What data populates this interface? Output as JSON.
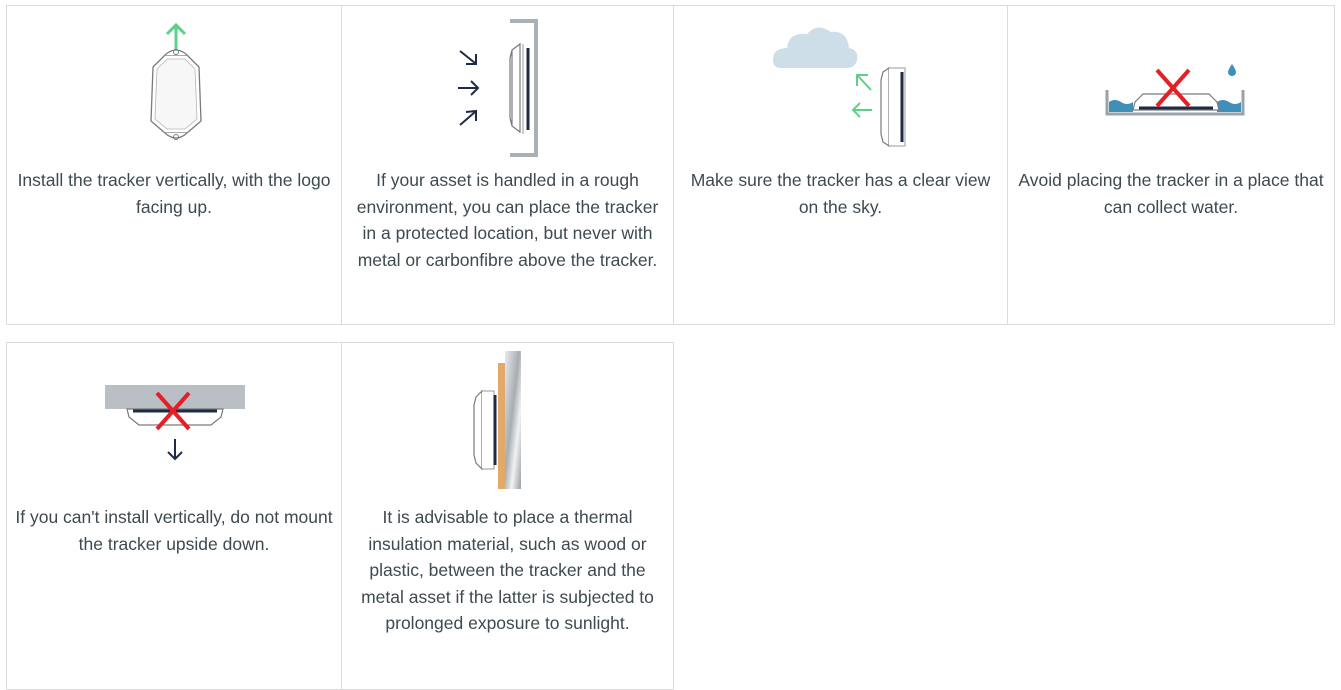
{
  "colors": {
    "arrow_green": "#5fd08a",
    "arrow_navy": "#1f2a44",
    "cross_red": "#e51f26",
    "water_blue": "#3f8fb8",
    "cloud": "#cddee9",
    "wood": "#e2a96b",
    "card_border": "#dcdcdc"
  },
  "tips": [
    {
      "caption": "Install the tracker vertically, with the logo facing up.",
      "illustration": "tracker-vertical-arrow-up"
    },
    {
      "caption": "If your asset is handled in a rough environment, you can place the tracker in a protected location, but never with metal or carbonfibre above the tracker.",
      "illustration": "tracker-protected-bracket"
    },
    {
      "caption": "Make sure the tracker has a clear view on the sky.",
      "illustration": "tracker-sky-view-cloud"
    },
    {
      "caption": "Avoid placing the tracker in a place that can collect water.",
      "illustration": "tracker-water-crossed"
    },
    {
      "caption": "If you can't install vertically, do not mount the tracker upside down.",
      "illustration": "tracker-upside-down-crossed"
    },
    {
      "caption": "It is advisable to place a thermal insulation material, such as wood or plastic, between the tracker and the metal asset if the latter is subjected to prolonged exposure to sunlight.",
      "illustration": "tracker-thermal-insulation"
    }
  ]
}
